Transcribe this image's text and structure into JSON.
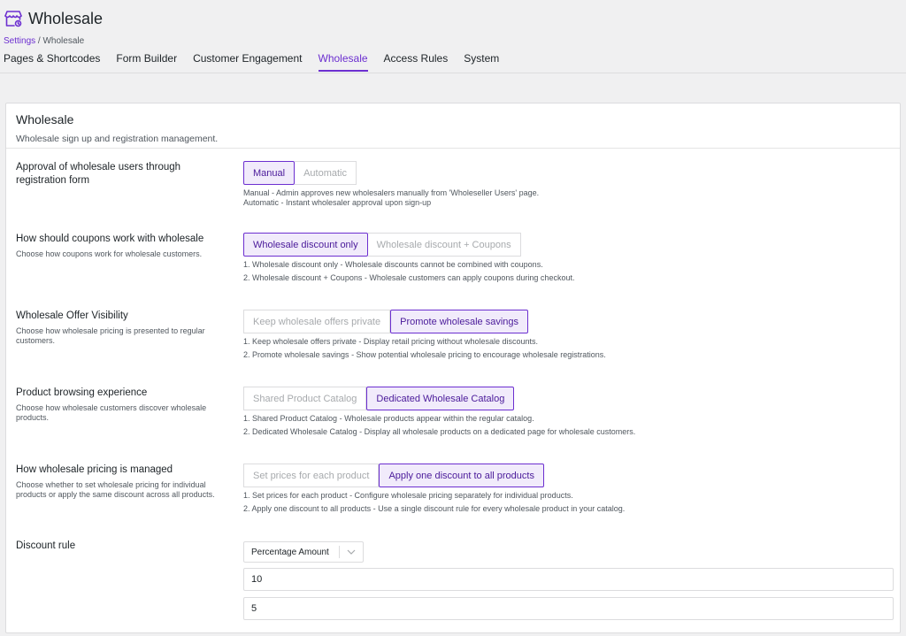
{
  "header": {
    "title": "Wholesale",
    "breadcrumb": {
      "link": "Settings",
      "separator": " / ",
      "current": "Wholesale"
    },
    "tabs": [
      {
        "label": "Pages & Shortcodes"
      },
      {
        "label": "Form Builder"
      },
      {
        "label": "Customer Engagement"
      },
      {
        "label": "Wholesale",
        "active": true
      },
      {
        "label": "Access Rules"
      },
      {
        "label": "System"
      }
    ]
  },
  "card": {
    "title": "Wholesale",
    "description": "Wholesale sign up and registration management."
  },
  "settings": {
    "approval": {
      "label": "Approval of wholesale users through registration form",
      "options": [
        "Manual",
        "Automatic"
      ],
      "selected": "Manual",
      "help": [
        "Manual - Admin approves new wholesalers manually from 'Wholeseller Users' page.",
        "Automatic - Instant wholesaler approval upon sign-up"
      ]
    },
    "coupons": {
      "label": "How should coupons work with wholesale",
      "subtitle": "Choose how coupons work for wholesale customers.",
      "options": [
        "Wholesale discount only",
        "Wholesale discount + Coupons"
      ],
      "selected": "Wholesale discount only",
      "help": [
        "1. Wholesale discount only - Wholesale discounts cannot be combined with coupons.",
        "2. Wholesale discount + Coupons - Wholesale customers can apply coupons during checkout."
      ]
    },
    "visibility": {
      "label": "Wholesale Offer Visibility",
      "subtitle": "Choose how wholesale pricing is presented to regular customers.",
      "options": [
        "Keep wholesale offers private",
        "Promote wholesale savings"
      ],
      "selected": "Promote wholesale savings",
      "help": [
        "1. Keep wholesale offers private - Display retail pricing without wholesale discounts.",
        "2. Promote wholesale savings - Show potential wholesale pricing to encourage wholesale registrations."
      ]
    },
    "browsing": {
      "label": "Product browsing experience",
      "subtitle": "Choose how wholesale customers discover wholesale products.",
      "options": [
        "Shared Product Catalog",
        "Dedicated Wholesale Catalog"
      ],
      "selected": "Dedicated Wholesale Catalog",
      "help": [
        "1. Shared Product Catalog - Wholesale products appear within the regular catalog.",
        "2. Dedicated Wholesale Catalog - Display all wholesale products on a dedicated page for wholesale customers."
      ]
    },
    "pricing": {
      "label": "How wholesale pricing is managed",
      "subtitle": "Choose whether to set wholesale pricing for individual products or apply the same discount across all products.",
      "options": [
        "Set prices for each product",
        "Apply one discount to all products"
      ],
      "selected": "Apply one discount to all products",
      "help": [
        "1. Set prices for each product - Configure wholesale pricing separately for individual products.",
        "2. Apply one discount to all products - Use a single discount rule for every wholesale product in your catalog."
      ]
    },
    "discount_rule": {
      "label": "Discount rule",
      "type_selected": "Percentage Amount",
      "value_1": "10",
      "value_2": "5"
    }
  },
  "colors": {
    "accent": "#6c2fd0",
    "selected_bg": "#f1ebfb",
    "border": "#dcdcde"
  }
}
